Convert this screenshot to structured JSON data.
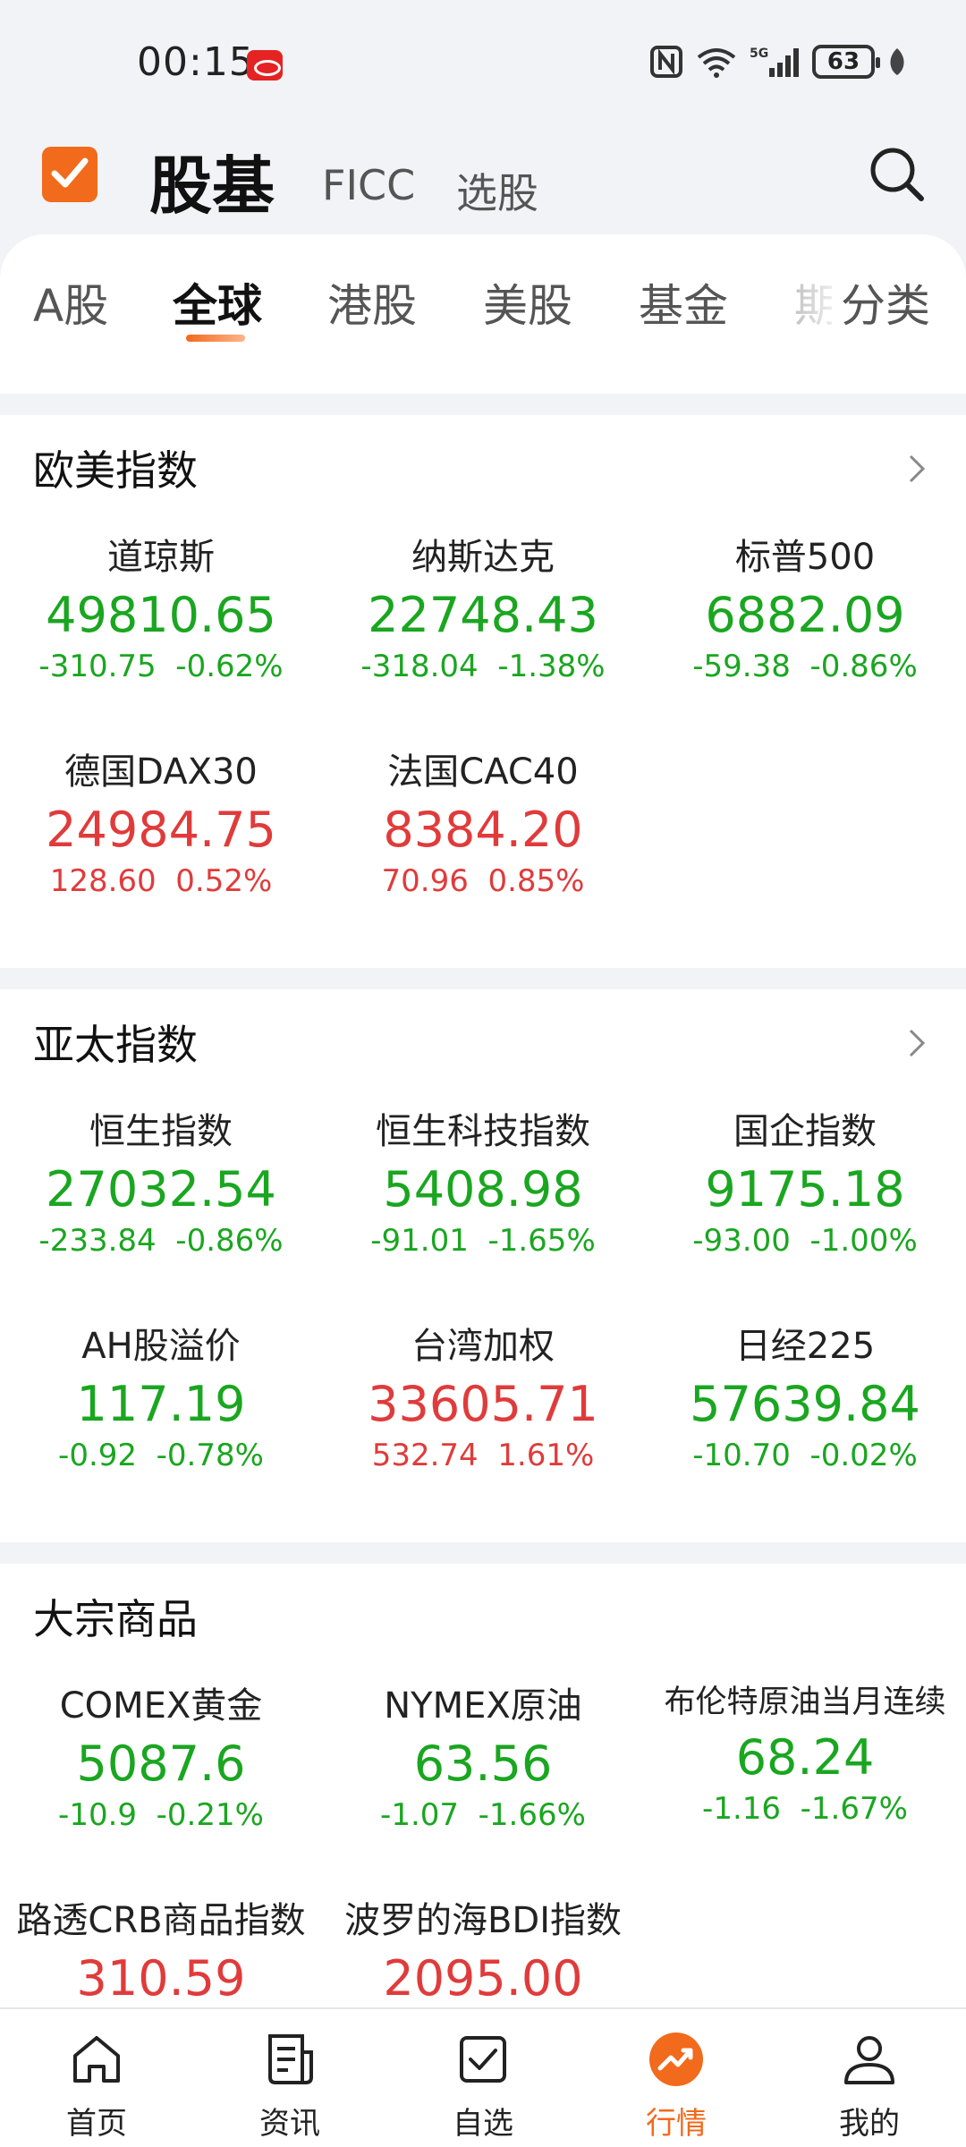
{
  "status_bar": {
    "time": "00:15",
    "battery": "63"
  },
  "header": {
    "tabs": [
      {
        "label": "股基",
        "active": true
      },
      {
        "label": "FICC"
      },
      {
        "label": "选股"
      }
    ]
  },
  "subtabs": {
    "items": [
      "A股",
      "全球",
      "港股",
      "美股",
      "基金",
      "期"
    ],
    "active": "全球",
    "category_label": "分类"
  },
  "sections": [
    {
      "title": "欧美指数",
      "has_arrow": true,
      "items": [
        {
          "name": "道琼斯",
          "price": "49810.65",
          "change": "-310.75",
          "pct": "-0.62%",
          "dir": "down"
        },
        {
          "name": "纳斯达克",
          "price": "22748.43",
          "change": "-318.04",
          "pct": "-1.38%",
          "dir": "down"
        },
        {
          "name": "标普500",
          "price": "6882.09",
          "change": "-59.38",
          "pct": "-0.86%",
          "dir": "down"
        },
        {
          "name": "德国DAX30",
          "price": "24984.75",
          "change": "128.60",
          "pct": "0.52%",
          "dir": "up"
        },
        {
          "name": "法国CAC40",
          "price": "8384.20",
          "change": "70.96",
          "pct": "0.85%",
          "dir": "up"
        }
      ]
    },
    {
      "title": "亚太指数",
      "has_arrow": true,
      "items": [
        {
          "name": "恒生指数",
          "price": "27032.54",
          "change": "-233.84",
          "pct": "-0.86%",
          "dir": "down"
        },
        {
          "name": "恒生科技指数",
          "price": "5408.98",
          "change": "-91.01",
          "pct": "-1.65%",
          "dir": "down"
        },
        {
          "name": "国企指数",
          "price": "9175.18",
          "change": "-93.00",
          "pct": "-1.00%",
          "dir": "down"
        },
        {
          "name": "AH股溢价",
          "price": "117.19",
          "change": "-0.92",
          "pct": "-0.78%",
          "dir": "down"
        },
        {
          "name": "台湾加权",
          "price": "33605.71",
          "change": "532.74",
          "pct": "1.61%",
          "dir": "up"
        },
        {
          "name": "日经225",
          "price": "57639.84",
          "change": "-10.70",
          "pct": "-0.02%",
          "dir": "down"
        }
      ]
    },
    {
      "title": "大宗商品",
      "has_arrow": false,
      "items": [
        {
          "name": "COMEX黄金",
          "price": "5087.6",
          "change": "-10.9",
          "pct": "-0.21%",
          "dir": "down"
        },
        {
          "name": "NYMEX原油",
          "price": "63.56",
          "change": "-1.07",
          "pct": "-1.66%",
          "dir": "down"
        },
        {
          "name": "布伦特原油当月连续",
          "price": "68.24",
          "change": "-1.16",
          "pct": "-1.67%",
          "dir": "down"
        },
        {
          "name": "路透CRB商品指数",
          "price": "310.59",
          "change": "",
          "pct": "",
          "dir": "up"
        },
        {
          "name": "波罗的海BDI指数",
          "price": "2095.00",
          "change": "",
          "pct": "",
          "dir": "up"
        }
      ]
    }
  ],
  "bottom_nav": [
    {
      "label": "首页",
      "icon": "home-icon"
    },
    {
      "label": "资讯",
      "icon": "news-icon"
    },
    {
      "label": "自选",
      "icon": "watchlist-icon"
    },
    {
      "label": "行情",
      "icon": "market-icon",
      "active": true
    },
    {
      "label": "我的",
      "icon": "profile-icon"
    }
  ],
  "colors": {
    "accent": "#F26A1B",
    "up": "#E03B3B",
    "down": "#1AA620"
  }
}
